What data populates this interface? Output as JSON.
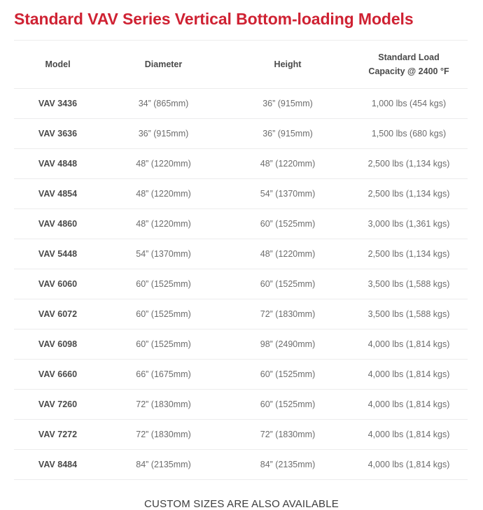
{
  "title": "Standard VAV Series Vertical Bottom-loading Models",
  "accent_color": "#cf2233",
  "text_color": "#4a4a4a",
  "cell_color": "#6c6c6c",
  "border_color": "#ececed",
  "table": {
    "columns": [
      {
        "key": "model",
        "label": "Model",
        "label_line2": ""
      },
      {
        "key": "diameter",
        "label": "Diameter",
        "label_line2": ""
      },
      {
        "key": "height",
        "label": "Height",
        "label_line2": ""
      },
      {
        "key": "load",
        "label": "Standard Load",
        "label_line2": "Capacity @ 2400 °F"
      }
    ],
    "rows": [
      {
        "model": "VAV 3436",
        "diameter": "34” (865mm)",
        "height": "36” (915mm)",
        "load": "1,000 lbs (454 kgs)"
      },
      {
        "model": "VAV 3636",
        "diameter": "36” (915mm)",
        "height": "36” (915mm)",
        "load": "1,500 lbs (680 kgs)"
      },
      {
        "model": "VAV 4848",
        "diameter": "48” (1220mm)",
        "height": "48” (1220mm)",
        "load": "2,500 lbs (1,134 kgs)"
      },
      {
        "model": "VAV 4854",
        "diameter": "48” (1220mm)",
        "height": "54” (1370mm)",
        "load": "2,500 lbs (1,134 kgs)"
      },
      {
        "model": "VAV 4860",
        "diameter": "48” (1220mm)",
        "height": "60” (1525mm)",
        "load": "3,000 lbs (1,361 kgs)"
      },
      {
        "model": "VAV 5448",
        "diameter": "54” (1370mm)",
        "height": "48” (1220mm)",
        "load": "2,500 lbs (1,134 kgs)"
      },
      {
        "model": "VAV 6060",
        "diameter": "60” (1525mm)",
        "height": "60” (1525mm)",
        "load": "3,500 lbs (1,588 kgs)"
      },
      {
        "model": "VAV 6072",
        "diameter": "60” (1525mm)",
        "height": "72” (1830mm)",
        "load": "3,500 lbs (1,588 kgs)"
      },
      {
        "model": "VAV 6098",
        "diameter": "60” (1525mm)",
        "height": "98” (2490mm)",
        "load": "4,000 lbs (1,814 kgs)"
      },
      {
        "model": "VAV 6660",
        "diameter": "66” (1675mm)",
        "height": "60” (1525mm)",
        "load": "4,000 lbs (1,814 kgs)"
      },
      {
        "model": "VAV 7260",
        "diameter": "72” (1830mm)",
        "height": "60” (1525mm)",
        "load": "4,000 lbs (1,814 kgs)"
      },
      {
        "model": "VAV 7272",
        "diameter": "72” (1830mm)",
        "height": "72” (1830mm)",
        "load": "4,000 lbs (1,814 kgs)"
      },
      {
        "model": "VAV 8484",
        "diameter": "84” (2135mm)",
        "height": "84” (2135mm)",
        "load": "4,000 lbs (1,814 kgs)"
      }
    ]
  },
  "footer_note": "CUSTOM SIZES ARE ALSO AVAILABLE"
}
